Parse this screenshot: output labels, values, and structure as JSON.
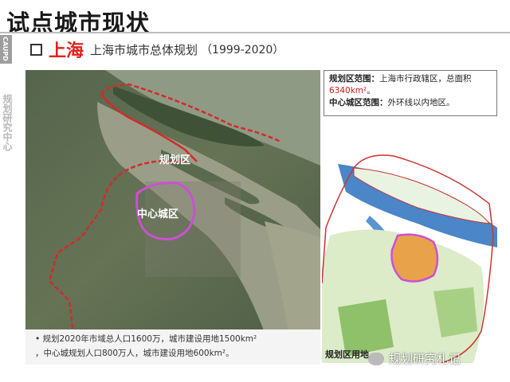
{
  "title": "试点城市现状",
  "side": {
    "logo_text": "CAUPD",
    "vertical_text": "规划研究中心"
  },
  "subtitle": {
    "city": "上海",
    "plan": "上海市城市总体规划",
    "years": "（1999-2020）"
  },
  "map_labels": {
    "planning_area": "规划区",
    "central_area": "中心城区"
  },
  "caption": {
    "line1": "• 规划2020年市域总人口1600万，城市建设用地1500km²",
    "line2": "，中心城规划人口800万人，城市建设用地600km²。"
  },
  "info": {
    "planning_range_label": "规划区范围：",
    "planning_range_text": "上海市行政辖区，总面积",
    "area_value": "6340km²",
    "area_suffix": "。",
    "central_range_label": "中心城区范围：",
    "central_range_text": "外环线以内地区。"
  },
  "map2_label": "规划区用地",
  "watermark": "规划研究札记",
  "colors": {
    "accent_red": "#e0201d",
    "boundary_red": "#d42a2a",
    "central_magenta": "#cc4fd6"
  }
}
